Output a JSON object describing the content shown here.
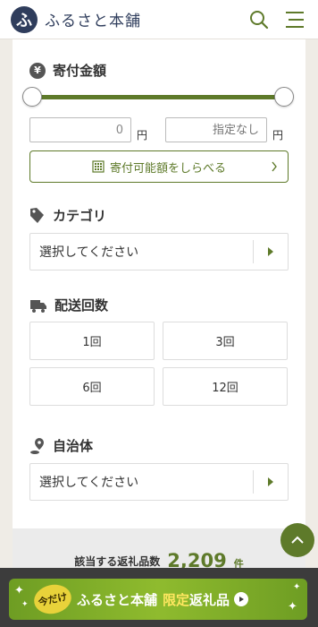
{
  "header": {
    "logo_mark": "ふ",
    "title": "ふるさと本舗",
    "search_icon": "search-icon",
    "menu_icon": "hamburger-menu-icon"
  },
  "donation": {
    "title": "寄付金額",
    "yen_symbol": "¥",
    "slider_min_percent": 0,
    "slider_max_percent": 100,
    "min_value": "0",
    "min_unit": "円",
    "max_placeholder": "指定なし",
    "max_unit": "円",
    "calc_button": "寄付可能額をしらべる"
  },
  "category": {
    "title": "カテゴリ",
    "placeholder": "選択してください"
  },
  "delivery": {
    "title": "配送回数",
    "options": [
      "1回",
      "3回",
      "6回",
      "12回"
    ]
  },
  "municipality": {
    "title": "自治体",
    "placeholder": "選択してください"
  },
  "result": {
    "label": "該当する返礼品数",
    "count": "2,209",
    "unit": "件"
  },
  "banner": {
    "badge": "今だけ",
    "brand": "ふるさと本舗",
    "highlight": "限定",
    "rest": "返礼品"
  },
  "colors": {
    "accent": "#5e7a2a",
    "logo": "#2f3d5c",
    "banner_highlight": "#ffe760"
  }
}
